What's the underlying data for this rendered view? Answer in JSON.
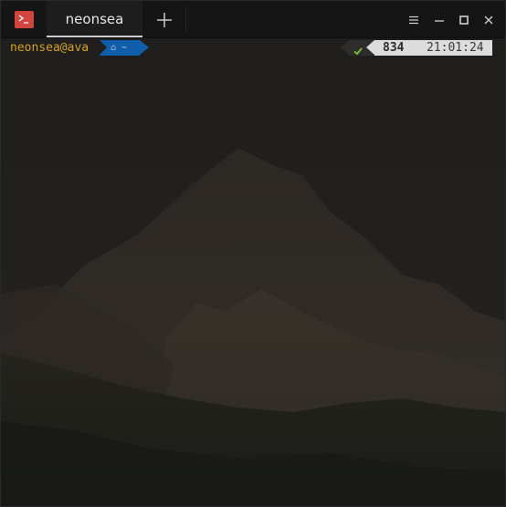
{
  "tab": {
    "title": "neonsea"
  },
  "prompt": {
    "user_host": "neonsea@ava",
    "directory": "⌂ ~",
    "exit_count": "834",
    "time": "21:01:24"
  },
  "icons": {
    "app": "terminal-icon",
    "new_tab": "plus-icon",
    "menu": "hamburger-menu-icon",
    "minimize": "minimize-icon",
    "maximize": "maximize-icon",
    "close": "close-icon",
    "status": "checkmark-icon"
  },
  "colors": {
    "app_icon": "#d2453f",
    "user_text": "#d4a21e",
    "directory_segment": "#0f5ea9",
    "status_check": "#7bbf3a",
    "time_segment": "#dcdcdc"
  }
}
